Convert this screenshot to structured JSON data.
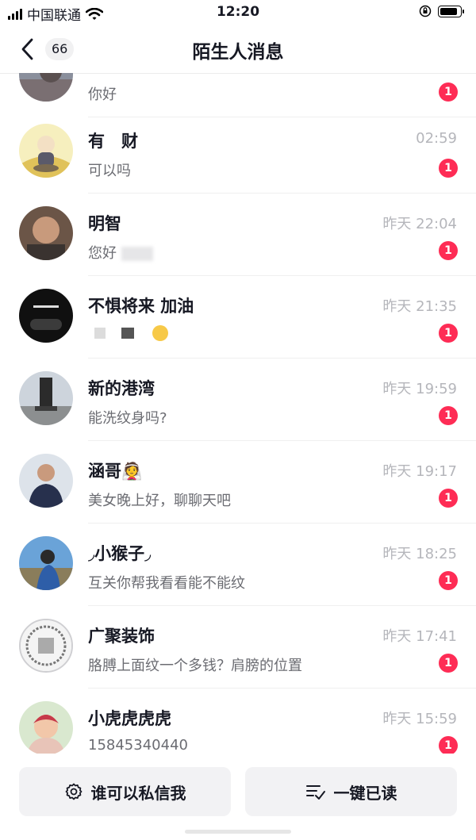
{
  "status_bar": {
    "carrier": "中国联通",
    "time": "12:20"
  },
  "nav": {
    "unread_count": "66",
    "title": "陌生人消息"
  },
  "conversations": [
    {
      "name": "",
      "time": "",
      "message": "你好",
      "badge": "1"
    },
    {
      "name": "有　财",
      "time": "02:59",
      "message": "可以吗",
      "badge": "1"
    },
    {
      "name": "明智",
      "time": "昨天 22:04",
      "message": "您好",
      "badge": "1"
    },
    {
      "name": "不惧将来  加油",
      "time": "昨天 21:35",
      "message": "",
      "badge": "1"
    },
    {
      "name": "新的港湾",
      "time": "昨天 19:59",
      "message": "能洗纹身吗?",
      "badge": "1"
    },
    {
      "name": "涵哥👰",
      "time": "昨天 19:17",
      "message": "美女晚上好，聊聊天吧",
      "badge": "1"
    },
    {
      "name": "◞小猴子◞",
      "time": "昨天 18:25",
      "message": "互关你帮我看看能不能纹",
      "badge": "1"
    },
    {
      "name": "广聚装饰",
      "time": "昨天 17:41",
      "message": "胳膊上面纹一个多钱？肩膀的位置",
      "badge": "1"
    },
    {
      "name": "小虎虎虎虎",
      "time": "昨天 15:59",
      "message": "15845340440",
      "badge": "1"
    }
  ],
  "bottom_actions": {
    "privacy_label": "谁可以私信我",
    "mark_read_label": "一键已读"
  },
  "colors": {
    "badge": "#fe2c55",
    "time_text": "#b5b6bb",
    "message_text": "#6b6c72",
    "button_bg": "#f2f2f4"
  },
  "icons": [
    "signal-icon",
    "wifi-icon",
    "orientation-lock-icon",
    "battery-icon",
    "back-arrow-icon",
    "gear-icon",
    "checklist-icon"
  ]
}
